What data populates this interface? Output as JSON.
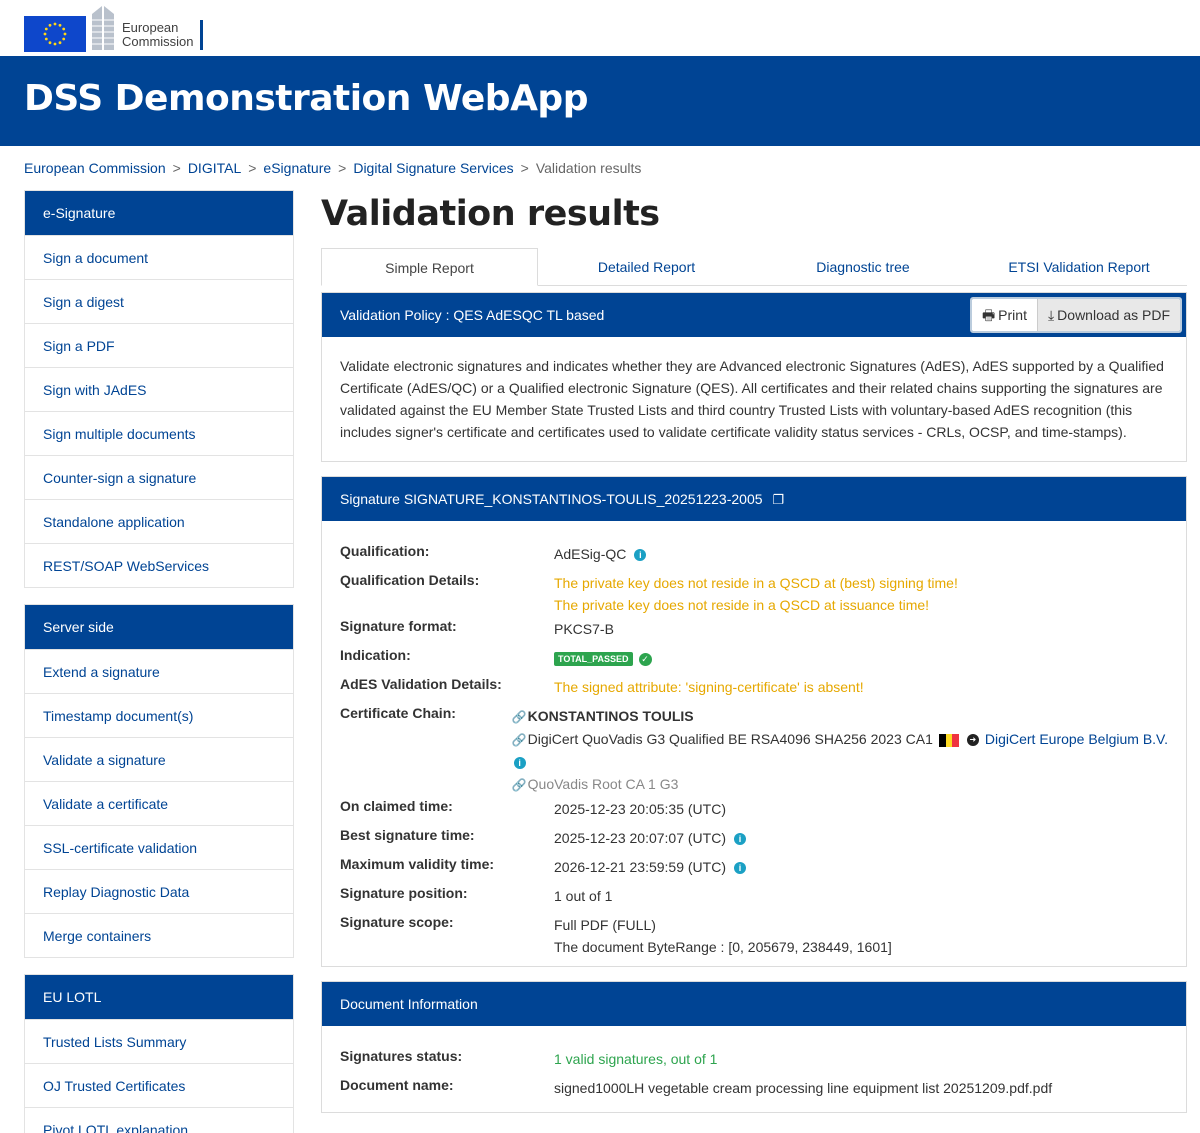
{
  "ec": {
    "line1": "European",
    "line2": "Commission"
  },
  "app_title": "DSS Demonstration WebApp",
  "breadcrumb": {
    "items": [
      "European Commission",
      "DIGITAL",
      "eSignature",
      "Digital Signature Services"
    ],
    "current": "Validation results",
    "separator": ">"
  },
  "sidebar": {
    "groups": [
      {
        "title": "e-Signature",
        "items": [
          "Sign a document",
          "Sign a digest",
          "Sign a PDF",
          "Sign with JAdES",
          "Sign multiple documents",
          "Counter-sign a signature",
          "Standalone application",
          "REST/SOAP WebServices"
        ]
      },
      {
        "title": "Server side",
        "items": [
          "Extend a signature",
          "Timestamp document(s)",
          "Validate a signature",
          "Validate a certificate",
          "SSL-certificate validation",
          "Replay Diagnostic Data",
          "Merge containers"
        ]
      },
      {
        "title": "EU LOTL",
        "items": [
          "Trusted Lists Summary",
          "OJ Trusted Certificates",
          "Pivot LOTL explanation"
        ]
      }
    ]
  },
  "page_title": "Validation results",
  "tabs": [
    "Simple Report",
    "Detailed Report",
    "Diagnostic tree",
    "ETSI Validation Report"
  ],
  "policy": {
    "title": "Validation Policy : QES AdESQC TL based",
    "print_label": "Print",
    "download_label": "Download as PDF",
    "description": "Validate electronic signatures and indicates whether they are Advanced electronic Signatures (AdES), AdES supported by a Qualified Certificate (AdES/QC) or a Qualified electronic Signature (QES). All certificates and their related chains supporting the signatures are validated against the EU Member State Trusted Lists and third country Trusted Lists with voluntary-based AdES recognition (this includes signer's certificate and certificates used to validate certificate validity status services - CRLs, OCSP, and time-stamps)."
  },
  "signature": {
    "title": "Signature SIGNATURE_KONSTANTINOS-TOULIS_20251223-2005",
    "labels": {
      "qualification": "Qualification:",
      "qualification_details": "Qualification Details:",
      "format": "Signature format:",
      "indication": "Indication:",
      "ades_details": "AdES Validation Details:",
      "chain": "Certificate Chain:",
      "claimed_time": "On claimed time:",
      "best_time": "Best signature time:",
      "max_validity": "Maximum validity time:",
      "position": "Signature position:",
      "scope": "Signature scope:"
    },
    "qualification": "AdESig-QC",
    "qualification_details": [
      "The private key does not reside in a QSCD at (best) signing time!",
      "The private key does not reside in a QSCD at issuance time!"
    ],
    "format": "PKCS7-B",
    "indication": "TOTAL_PASSED",
    "ades_details": "The signed attribute: 'signing-certificate' is absent!",
    "chain": {
      "signer": "KONSTANTINOS TOULIS",
      "issuer": "DigiCert QuoVadis G3 Qualified BE RSA4096 SHA256 2023 CA1",
      "tsp_link": "DigiCert Europe Belgium B.V.",
      "root": "QuoVadis Root CA 1 G3"
    },
    "claimed_time": "2025-12-23 20:05:35 (UTC)",
    "best_time": "2025-12-23 20:07:07 (UTC)",
    "max_validity": "2026-12-21 23:59:59 (UTC)",
    "position": "1 out of 1",
    "scope": [
      "Full PDF (FULL)",
      "The document ByteRange : [0, 205679, 238449, 1601]"
    ]
  },
  "document": {
    "title": "Document Information",
    "labels": {
      "status": "Signatures status:",
      "name": "Document name:"
    },
    "status": "1 valid signatures, out of 1",
    "name": "signed1000LH vegetable cream processing line equipment list 20251209.pdf.pdf"
  },
  "colors": {
    "brand": "#004494",
    "warning": "#e6a800",
    "success": "#2da44e",
    "info": "#1ba0c4"
  },
  "icons": {
    "print": "print-icon",
    "download": "download-icon",
    "copy": "copy-icon",
    "info": "info-icon",
    "check": "check-circle-icon",
    "link": "link-icon",
    "arrow": "arrow-circle-right-icon",
    "flag": "belgium-flag-icon"
  }
}
